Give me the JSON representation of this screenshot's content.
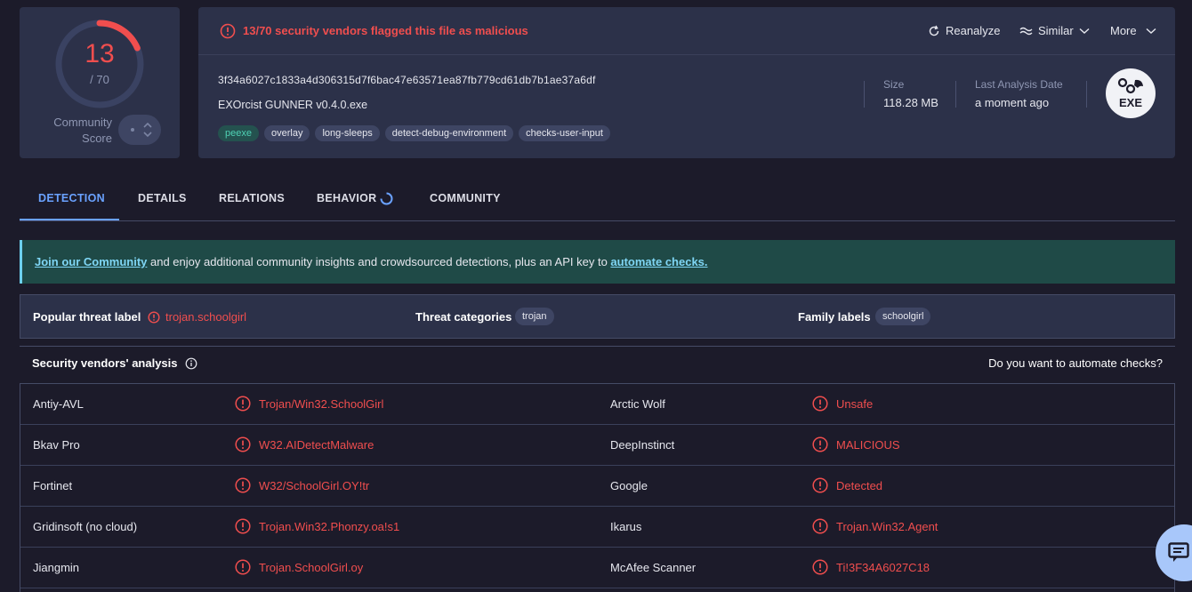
{
  "score": {
    "detections": "13",
    "total": "/ 70",
    "detections_fraction": 0.1857,
    "community_label": "Community Score"
  },
  "alert": {
    "text": "13/70 security vendors flagged this file as malicious",
    "color": "#f04e4e"
  },
  "actions": {
    "reanalyze": "Reanalyze",
    "similar": "Similar",
    "more": "More"
  },
  "file": {
    "hash": "3f34a6027c1833a4d306315d7f6bac47e63571ea87fb779cd61db7b1ae37a6df",
    "name": "EXOrcist GUNNER v0.4.0.exe",
    "tags": [
      "peexe",
      "overlay",
      "long-sleeps",
      "detect-debug-environment",
      "checks-user-input"
    ],
    "size_label": "Size",
    "size_value": "118.28 MB",
    "date_label": "Last Analysis Date",
    "date_value": "a moment ago",
    "type_badge": "EXE"
  },
  "tabs": [
    "DETECTION",
    "DETAILS",
    "RELATIONS",
    "BEHAVIOR",
    "COMMUNITY"
  ],
  "banner": {
    "link1": "Join our Community",
    "middle": " and enjoy additional community insights and crowdsourced detections, plus an API key to ",
    "link2": "automate checks."
  },
  "threat": {
    "popular_label": "Popular threat label",
    "popular_value": "trojan.schoolgirl",
    "categories_label": "Threat categories",
    "categories_value": "trojan",
    "family_label": "Family labels",
    "family_value": "schoolgirl"
  },
  "vendors": {
    "title": "Security vendors' analysis",
    "cta": "Do you want to automate checks?",
    "rows": [
      {
        "left_name": "Antiy-AVL",
        "left_result": "Trojan/Win32.SchoolGirl",
        "right_name": "Arctic Wolf",
        "right_result": "Unsafe"
      },
      {
        "left_name": "Bkav Pro",
        "left_result": "W32.AIDetectMalware",
        "right_name": "DeepInstinct",
        "right_result": "MALICIOUS"
      },
      {
        "left_name": "Fortinet",
        "left_result": "W32/SchoolGirl.OY!tr",
        "right_name": "Google",
        "right_result": "Detected"
      },
      {
        "left_name": "Gridinsoft (no cloud)",
        "left_result": "Trojan.Win32.Phonzy.oa!s1",
        "right_name": "Ikarus",
        "right_result": "Trojan.Win32.Agent"
      },
      {
        "left_name": "Jiangmin",
        "left_result": "Trojan.SchoolGirl.oy",
        "right_name": "McAfee Scanner",
        "right_result": "Ti!3F34A6027C18"
      }
    ]
  }
}
